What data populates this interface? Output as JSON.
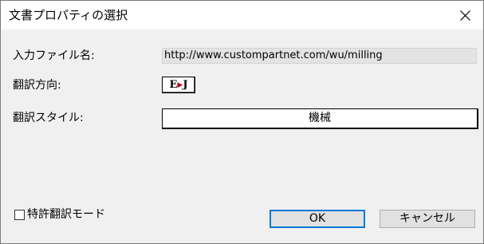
{
  "window": {
    "title": "文書プロパティの選択"
  },
  "form": {
    "file_label": "入力ファイル名:",
    "file_value": "http://www.custompartnet.com/wu/milling",
    "direction_label": "翻訳方向:",
    "direction_from": "E",
    "direction_arrow": "▶",
    "direction_to": "J",
    "style_label": "翻訳スタイル:",
    "style_value": "機械"
  },
  "footer": {
    "patent_mode_label": "特許翻訳モード",
    "patent_mode_checked": false,
    "ok_label": "OK",
    "cancel_label": "キャンセル"
  },
  "icons": {
    "close": "close-icon"
  },
  "colors": {
    "dialog_bg": "#f0f0f0",
    "title_bg": "#ffffff",
    "field_bg": "#e3e3e3",
    "default_button_border": "#0078d7",
    "arrow_red": "#c0001a"
  }
}
